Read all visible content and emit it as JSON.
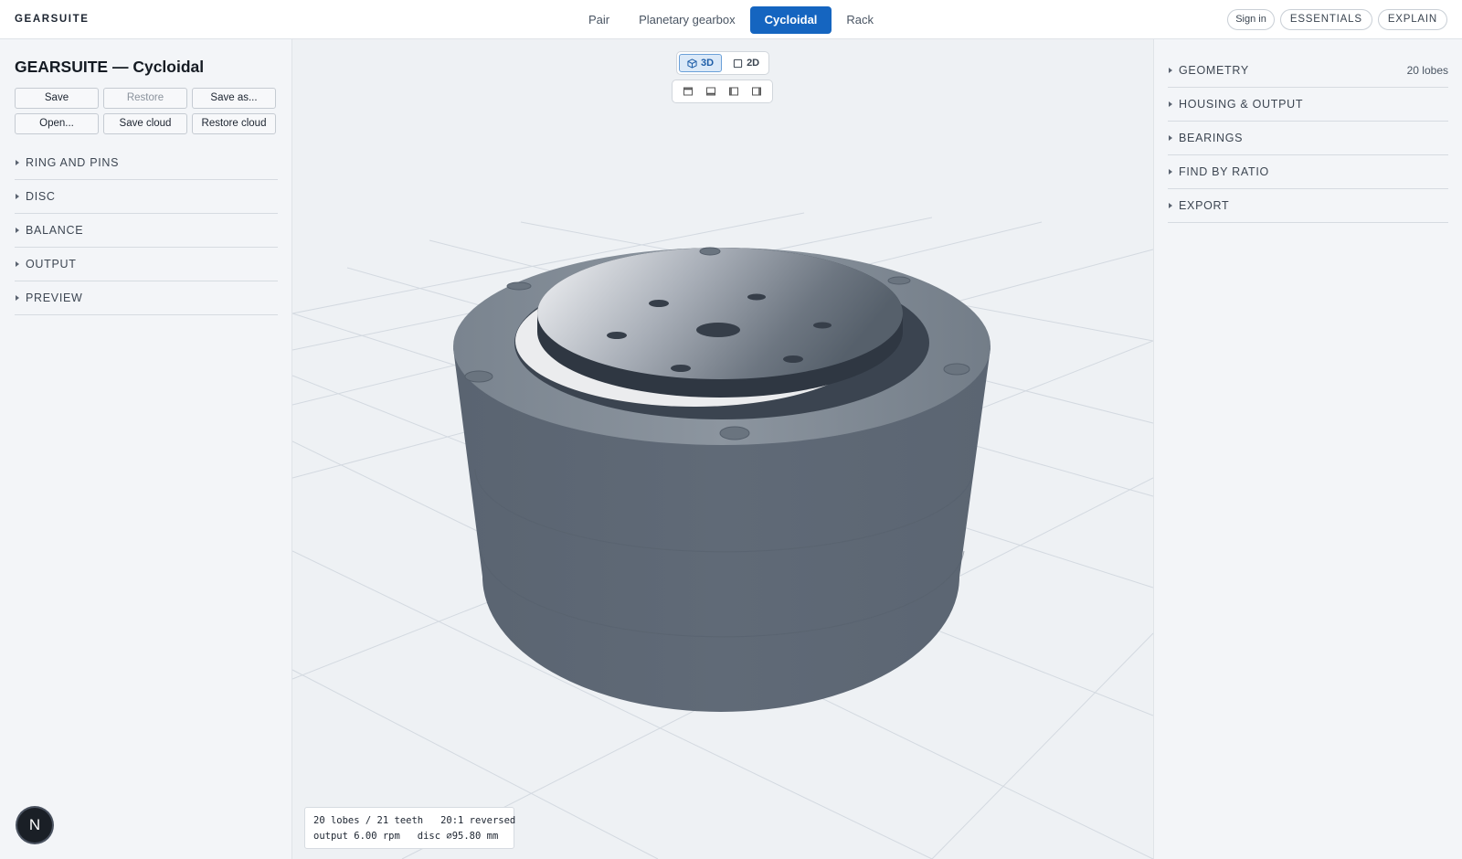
{
  "app": {
    "logo": "GEARSUITE"
  },
  "nav": {
    "tabs": [
      "Pair",
      "Planetary gearbox",
      "Cycloidal",
      "Rack"
    ],
    "active": 2
  },
  "header_actions": {
    "signin": "Sign in",
    "essentials": "ESSENTIALS",
    "explain": "EXPLAIN"
  },
  "left": {
    "title": "GEARSUITE — Cycloidal",
    "buttons": {
      "save": "Save",
      "restore": "Restore",
      "save_as": "Save as...",
      "open": "Open...",
      "save_cloud": "Save cloud",
      "restore_cloud": "Restore cloud"
    },
    "sections": [
      "RING AND PINS",
      "DISC",
      "BALANCE",
      "OUTPUT",
      "PREVIEW"
    ]
  },
  "viewport": {
    "toggle": {
      "mode_3d": "3D",
      "mode_2d": "2D",
      "active": "3D"
    },
    "camera_buttons": [
      "view-top-icon",
      "view-bottom-icon",
      "view-left-icon",
      "view-right-icon"
    ],
    "info": {
      "line1": "20 lobes / 21 teeth   20:1 reversed",
      "line2": "output 6.00 rpm   disc ⌀95.80 mm"
    },
    "model_color": "#5f6a77"
  },
  "right": {
    "sections": [
      {
        "label": "GEOMETRY",
        "value": "20 lobes"
      },
      {
        "label": "HOUSING & OUTPUT",
        "value": ""
      },
      {
        "label": "BEARINGS",
        "value": ""
      },
      {
        "label": "FIND BY RATIO",
        "value": ""
      },
      {
        "label": "EXPORT",
        "value": ""
      }
    ]
  },
  "fab": {
    "letter": "N"
  }
}
